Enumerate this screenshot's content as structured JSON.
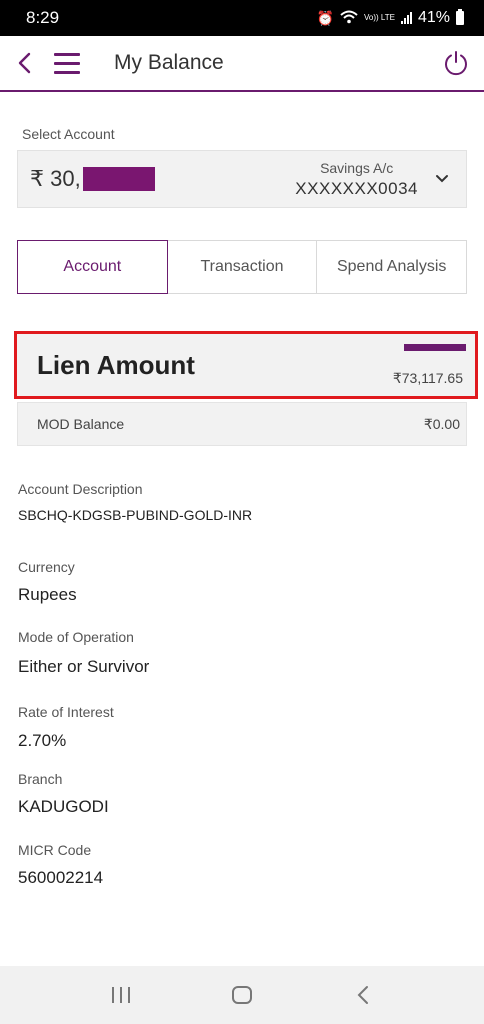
{
  "status_bar": {
    "time": "8:29",
    "battery": "41%",
    "network": "Vo)) LTE"
  },
  "header": {
    "title": "My Balance"
  },
  "account": {
    "select_label": "Select Account",
    "balance_prefix": "₹ 30,",
    "type": "Savings A/c",
    "number": "XXXXXXX0034"
  },
  "tabs": [
    {
      "label": "Account"
    },
    {
      "label": "Transaction"
    },
    {
      "label": "Spend Analysis"
    }
  ],
  "lien": {
    "title": "Lien Amount",
    "value": "₹73,117.65"
  },
  "mod": {
    "label": "MOD Balance",
    "value": "₹0.00"
  },
  "details": [
    {
      "label": "Account Description",
      "value": "SBCHQ-KDGSB-PUBIND-GOLD-INR"
    },
    {
      "label": "Currency",
      "value": "Rupees"
    },
    {
      "label": "Mode of Operation",
      "value": "Either or Survivor"
    },
    {
      "label": "Rate of Interest",
      "value": "2.70%"
    },
    {
      "label": "Branch",
      "value": "KADUGODI"
    },
    {
      "label": "MICR Code",
      "value": "560002214"
    }
  ],
  "colors": {
    "accent": "#6a1b6e",
    "highlight": "#e0191e",
    "panel": "#f2f2f2"
  },
  "icons": [
    "back-arrow-icon",
    "hamburger-menu-icon",
    "power-icon",
    "chevron-down-icon",
    "recent-apps-icon",
    "home-icon",
    "back-icon"
  ]
}
